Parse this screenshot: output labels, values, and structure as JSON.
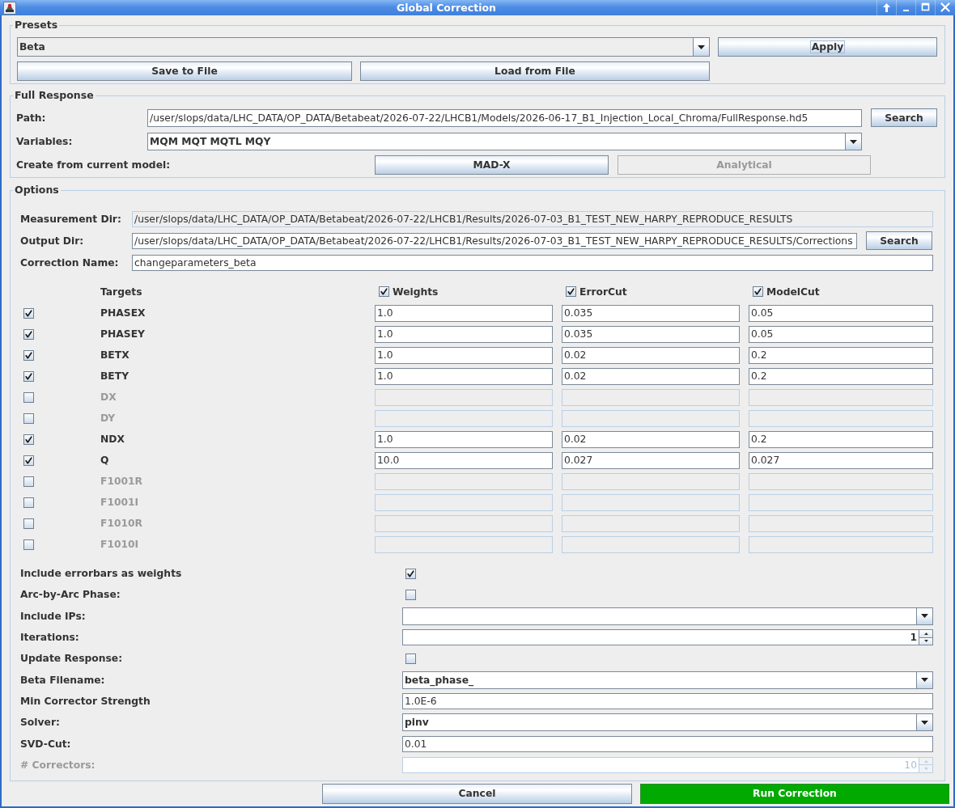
{
  "window": {
    "title": "Global Correction"
  },
  "presets": {
    "title": "Presets",
    "value": "Beta",
    "apply_button": {
      "label": "Apply",
      "focused": true
    },
    "file_buttons": [
      "Save to File",
      "Load from File"
    ]
  },
  "full_response": {
    "title": "Full Response",
    "path": {
      "label": "Path:",
      "value": "/user/slops/data/LHC_DATA/OP_DATA/Betabeat/2026-07-22/LHCB1/Models/2026-06-17_B1_Injection_Local_Chroma/FullResponse.hd5",
      "button": "Search"
    },
    "variables": {
      "label": "Variables:",
      "value": "MQM MQT MQTL MQY"
    },
    "create": {
      "label": "Create from current model:",
      "buttons": [
        {
          "label": "MAD-X",
          "disabled": false
        },
        {
          "label": "Analytical",
          "disabled": true
        }
      ]
    }
  },
  "options": {
    "title": "Options",
    "fields": [
      {
        "label": "Measurement Dir:",
        "value": "/user/slops/data/LHC_DATA/OP_DATA/Betabeat/2026-07-22/LHCB1/Results/2026-07-03_B1_TEST_NEW_HARPY_REPRODUCE_RESULTS",
        "editable": false
      },
      {
        "label": "Output Dir:",
        "value": "/user/slops/data/LHC_DATA/OP_DATA/Betabeat/2026-07-22/LHCB1/Results/2026-07-03_B1_TEST_NEW_HARPY_REPRODUCE_RESULTS/Corrections",
        "editable": true,
        "button": "Search"
      },
      {
        "label": "Correction Name:",
        "value": "changeparameters_beta",
        "editable": true
      }
    ],
    "targets": {
      "heading": "Targets",
      "columns": [
        {
          "label": "Weights",
          "checked": true
        },
        {
          "label": "ErrorCut",
          "checked": true
        },
        {
          "label": "ModelCut",
          "checked": true
        }
      ],
      "rows": [
        {
          "name": "PHASEX",
          "checked": true,
          "values": [
            "1.0",
            "0.035",
            "0.05"
          ]
        },
        {
          "name": "PHASEY",
          "checked": true,
          "values": [
            "1.0",
            "0.035",
            "0.05"
          ]
        },
        {
          "name": "BETX",
          "checked": true,
          "values": [
            "1.0",
            "0.02",
            "0.2"
          ]
        },
        {
          "name": "BETY",
          "checked": true,
          "values": [
            "1.0",
            "0.02",
            "0.2"
          ]
        },
        {
          "name": "DX",
          "checked": false
        },
        {
          "name": "DY",
          "checked": false
        },
        {
          "name": "NDX",
          "checked": true,
          "values": [
            "1.0",
            "0.02",
            "0.2"
          ]
        },
        {
          "name": "Q",
          "checked": true,
          "values": [
            "10.0",
            "0.027",
            "0.027"
          ]
        },
        {
          "name": "F1001R",
          "checked": false
        },
        {
          "name": "F1001I",
          "checked": false
        },
        {
          "name": "F1010R",
          "checked": false
        },
        {
          "name": "F1010I",
          "checked": false
        }
      ]
    },
    "settings": [
      {
        "kind": "checkbox",
        "label": "Include errorbars as weights",
        "checked": true,
        "disabled": false
      },
      {
        "kind": "checkbox",
        "label": "Arc-by-Arc Phase:",
        "checked": false,
        "disabled": false
      },
      {
        "kind": "combo",
        "label": "Include IPs:",
        "disabled": false
      },
      {
        "kind": "spinner",
        "label": "Iterations:",
        "value": "1",
        "disabled": false
      },
      {
        "kind": "checkbox",
        "label": "Update Response:",
        "checked": false,
        "disabled": false
      },
      {
        "kind": "combo",
        "label": "Beta Filename:",
        "value": "beta_phase_",
        "disabled": false
      },
      {
        "kind": "text",
        "label": "Min Corrector Strength",
        "value": "1.0E-6",
        "disabled": false
      },
      {
        "kind": "combo",
        "label": "Solver:",
        "value": "pinv",
        "disabled": false
      },
      {
        "kind": "text",
        "label": "SVD-Cut:",
        "value": "0.01",
        "disabled": false
      },
      {
        "kind": "spinner",
        "label": "# Correctors:",
        "value": "10",
        "disabled": true
      }
    ]
  },
  "buttons": [
    {
      "label": "Cancel",
      "kind": "normal"
    },
    {
      "label": "Run Correction",
      "kind": "primary"
    }
  ]
}
